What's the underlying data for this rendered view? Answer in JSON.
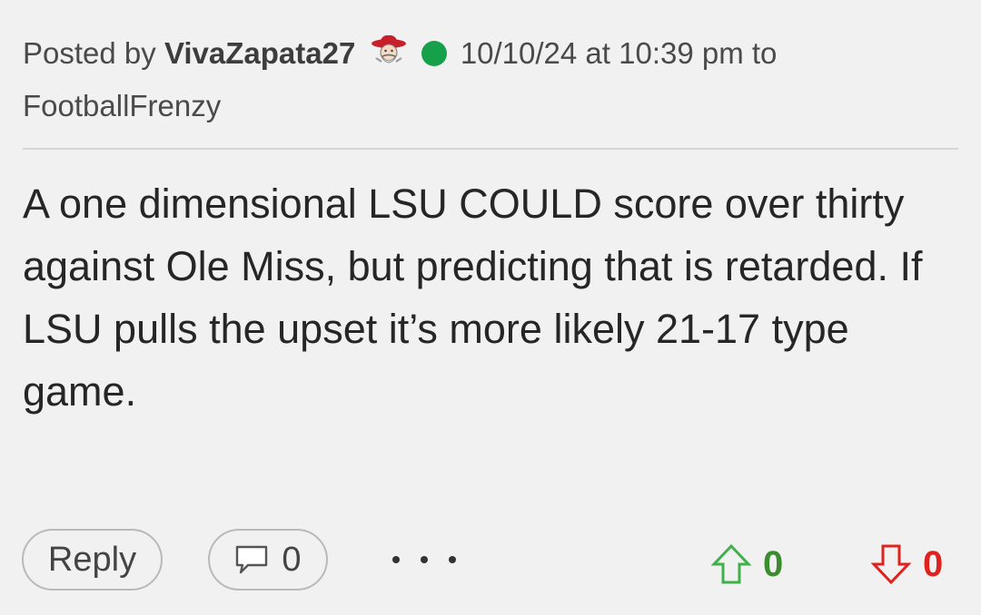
{
  "post": {
    "meta": {
      "posted_by_label": "Posted by",
      "username": "VivaZapata27",
      "avatar_icon": "rebel-mascot-icon",
      "online_status": "online",
      "online_color": "#16a04a",
      "timestamp": "10/10/24 at 10:39 pm",
      "to_label": "to",
      "board": "FootballFrenzy"
    },
    "body": "A one dimensional LSU COULD score over thirty against Ole Miss, but predicting that is retarded. If LSU pulls the upset it’s more likely 21-17 type game.",
    "actions": {
      "reply_label": "Reply",
      "comment_icon": "comment-bubble-icon",
      "comment_count": "0",
      "more_icon": "more-dots-icon",
      "upvote_icon": "arrow-up-icon",
      "upvote_count": "0",
      "upvote_color": "#3a8c2f",
      "downvote_icon": "arrow-down-icon",
      "downvote_count": "0",
      "downvote_color": "#e0221e"
    }
  }
}
